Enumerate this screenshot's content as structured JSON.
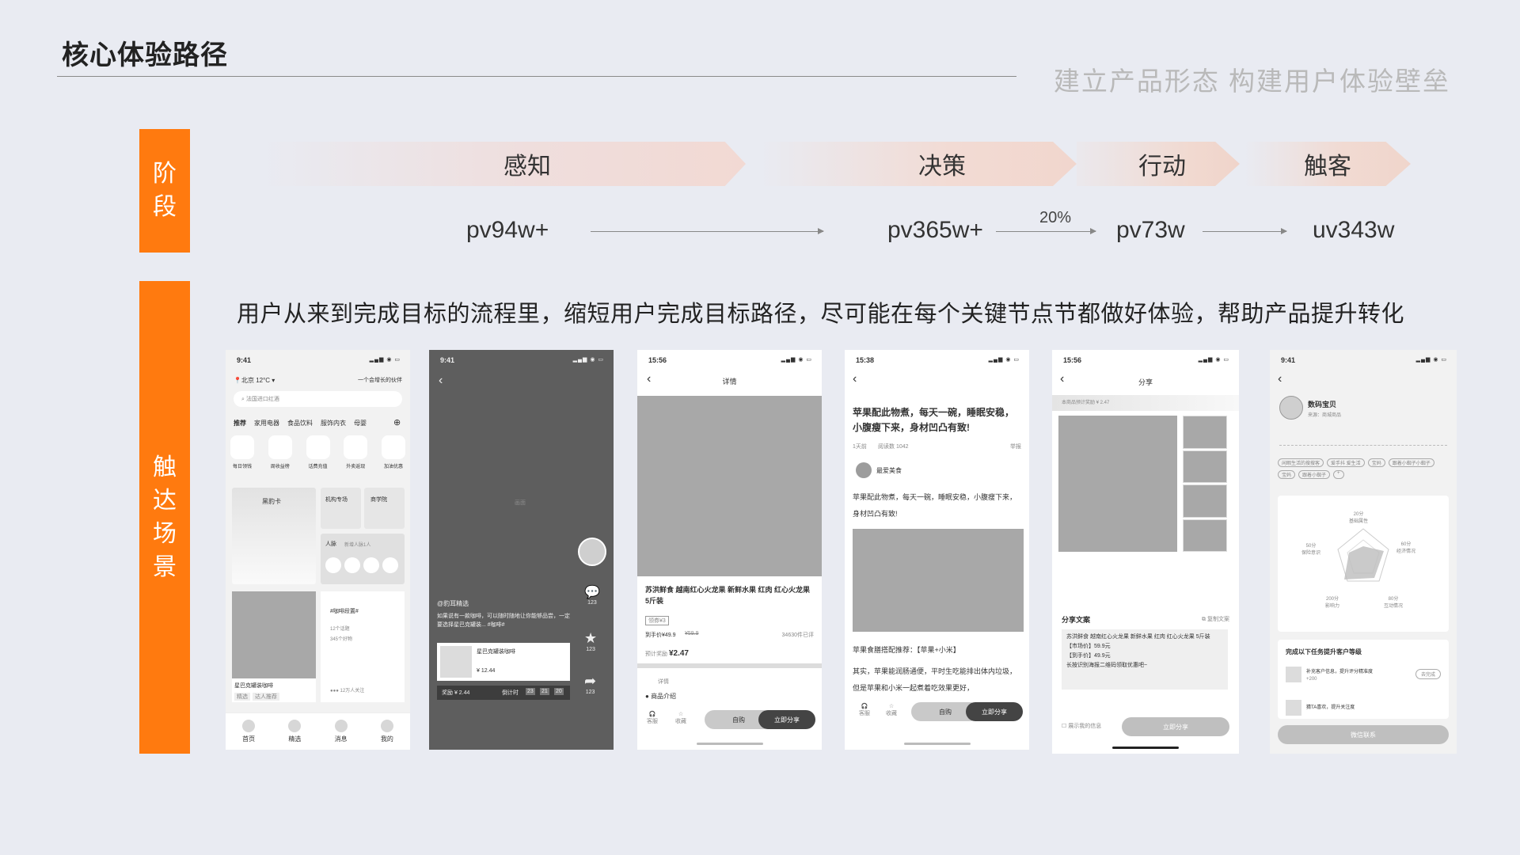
{
  "header": {
    "title": "核心体验路径",
    "subtitle": "建立产品形态 构建用户体验壁垒"
  },
  "sidebar": {
    "stage_label": "阶段",
    "scene_label": "触达场景"
  },
  "stages": [
    {
      "name": "感知",
      "metric": "pv94w+"
    },
    {
      "name": "决策",
      "metric": "pv365w+"
    },
    {
      "name": "行动",
      "metric": "pv73w"
    },
    {
      "name": "触客",
      "metric": "uv343w"
    }
  ],
  "conversion_rate": "20%",
  "description": "用户从来到完成目标的流程里，缩短用户完成目标路径，尽可能在每个关键节点节都做好体验，帮助产品提升转化",
  "colors": {
    "accent": "#ff7a0f",
    "background": "#e9ebf2",
    "phone_dark": "#5e5e5e",
    "placeholder": "#a8a8a8"
  },
  "screens": {
    "home": {
      "time": "9:41",
      "location": "北京 12°C",
      "slogan": "一个会增长的伙伴",
      "search_placeholder": "法国进口红酒",
      "tabs": [
        "推荐",
        "家用电器",
        "食品饮料",
        "服饰内衣",
        "母婴"
      ],
      "shortcuts": [
        "每日领钱",
        "周收益榜",
        "话费充值",
        "外卖返现",
        "加油优惠"
      ],
      "cards": {
        "leopard": "黑豹卡",
        "agency": "机构专场",
        "academy": "商学院",
        "network": "人脉",
        "network_sub": "新增人脉1人",
        "topic": "#咖啡段置#",
        "topic_count": "12个话题",
        "topic_likes": "345个好物",
        "product": "星巴克罐装咖啡",
        "tags": [
          "精选",
          "达人推荐"
        ],
        "follow": "12万人关注"
      },
      "nav": [
        "首页",
        "精选",
        "消息",
        "我的"
      ]
    },
    "video": {
      "time": "9:41",
      "frame_label": "画面",
      "author": "@豹耳精选",
      "caption": "如果说有一款咖啡，可以随时随地让你能够品尝，一定要选择星巴克罐装... #咖啡#",
      "product_name": "星巴克罐装咖啡",
      "product_price": "¥ 12.44",
      "reward": "奖励 ¥ 2.44",
      "countdown_label": "倒计时",
      "countdown": [
        "23",
        "21",
        "20"
      ],
      "counts": [
        "123",
        "123",
        "123"
      ]
    },
    "detail": {
      "time": "15:56",
      "title": "详情",
      "product": "苏洪鲜食 越南红心火龙果 新鲜水果 红肉 红心火龙果 5斤装",
      "badge": "领券¥3",
      "price_label": "到手价¥49.9",
      "orig_price": "¥59.9",
      "sold": "34630件已评",
      "reward_label": "预计奖励",
      "reward": "¥2.47",
      "section1": "详情",
      "section2": "商品介绍",
      "icon_labels": [
        "客服",
        "收藏"
      ],
      "buy": "自购",
      "share": "立即分享"
    },
    "article": {
      "time": "15:38",
      "title": "苹果配此物煮，每天一碗，睡眠安稳，小腹瘦下来，身材凹凸有致!",
      "meta_days": "1天前",
      "meta_reads": "阅读数 1042",
      "meta_report": "举报",
      "author": "最爱美食",
      "body": "苹果配此物煮，每天一碗，睡眠安稳，小腹瘦下来，身材凹凸有致!",
      "recommend": "苹果食膳搭配推荐：【苹果+小米】",
      "body2": "其实，苹果能润肠通便，平时生吃能排出体内垃圾，但是苹果和小米一起煮着吃效果更好，",
      "icon_labels": [
        "客服",
        "收藏"
      ],
      "buy": "自购",
      "share": "立即分享"
    },
    "share": {
      "time": "15:56",
      "title": "分享",
      "reward_hint": "本商品预计奖励 ¥ 2.47",
      "copy_title": "分享文案",
      "copy_action": "复制文案",
      "copy_lines": [
        "苏洪鲜食 越南红心火龙果 新鲜水果 红肉 红心火龙果 5斤装",
        "【市场价】59.9元",
        "【到手价】49.9元",
        "长按识别海报二维码领取优惠吧~"
      ],
      "show_my_info": "展示我的信息",
      "share_btn": "立即分享"
    },
    "profile": {
      "time": "9:41",
      "name": "数码宝贝",
      "source": "来源：商城商品",
      "tags": [
        "闲暇生活的搜搜客",
        "爱手抖 爱生活",
        "宝妈",
        "跟着小蜘子小蜘子",
        "宝妈",
        "跟着小蜘子"
      ],
      "radar": [
        {
          "label": "基础属性",
          "value": "20分"
        },
        {
          "label": "经济情况",
          "value": "60分"
        },
        {
          "label": "互动情况",
          "value": "80分"
        },
        {
          "label": "影响力",
          "value": "200分"
        },
        {
          "label": "保险意识",
          "value": "50分"
        }
      ],
      "task_title": "完成以下任务提升客户等级",
      "task1": "补充客户信息，提升评分精准度",
      "task1_reward": "+200",
      "task1_btn": "去完成",
      "task2": "猜TA喜欢，提升关注度",
      "wechat_btn": "微信联系"
    }
  }
}
